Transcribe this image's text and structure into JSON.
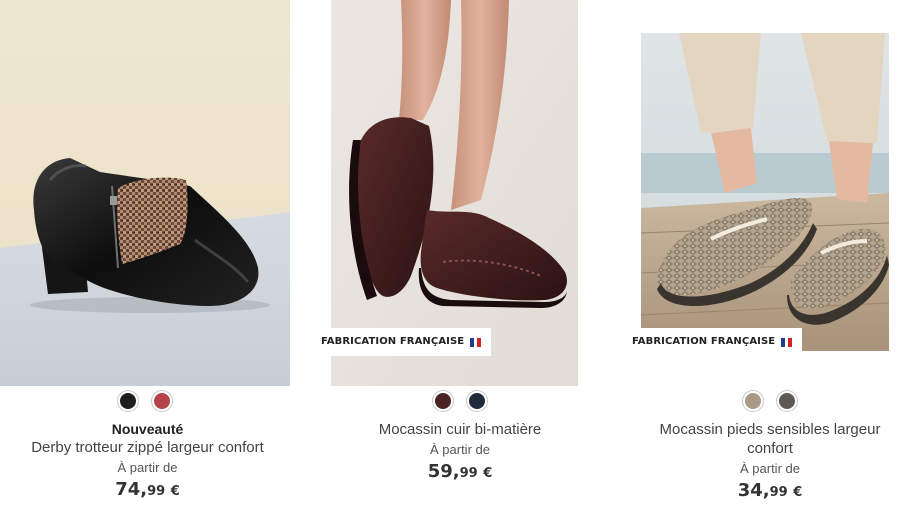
{
  "products": [
    {
      "tag": "Nouveauté",
      "title": "Derby trotteur zippé largeur confort",
      "price_prefix": "À partir de",
      "price_int": "74,",
      "price_dec": "99",
      "currency": "€",
      "swatches": [
        "#1e1e1e",
        "#b5444a"
      ],
      "image": "black-heeled-derby-ankle-shoe-photo"
    },
    {
      "badge": "FABRICATION FRANÇAISE",
      "title": "Mocassin cuir bi-matière",
      "price_prefix": "À partir de",
      "price_int": "59,",
      "price_dec": "99",
      "currency": "€",
      "swatches": [
        "#4a2424",
        "#1f2a3a"
      ],
      "image": "burgundy-leather-moccasin-photo"
    },
    {
      "badge": "FABRICATION FRANÇAISE",
      "title": "Mocassin pieds sensibles largeur confort",
      "price_prefix": "À partir de",
      "price_int": "34,",
      "price_dec": "99",
      "currency": "€",
      "swatches": [
        "#a99a88",
        "#5d5a56"
      ],
      "image": "snake-print-moccasin-photo"
    }
  ],
  "colors": {
    "flag_blue": "#1f3e8f",
    "flag_white": "#ffffff",
    "flag_red": "#d2232a"
  }
}
